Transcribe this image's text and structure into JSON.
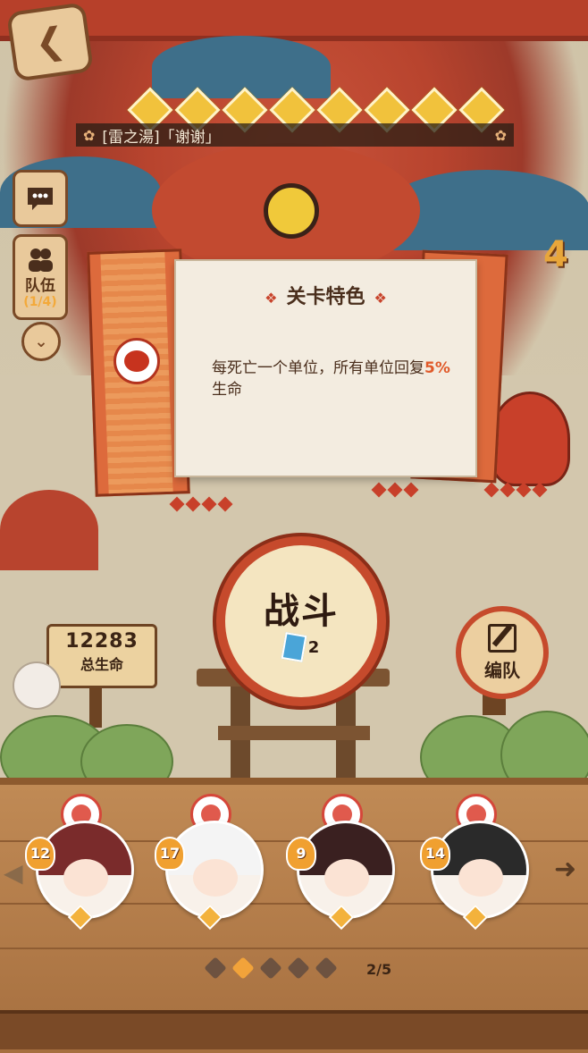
{
  "level": {
    "name": "[雷之湯]「谢谢」",
    "stars": 8
  },
  "sidebar": {
    "team_label": "队伍",
    "team_count": "(1/4)"
  },
  "wave_count": "4",
  "modal": {
    "title": "关卡特色",
    "text_before": "每死亡一个单位，所有单位回复",
    "highlight": "5%",
    "text_after": "生命"
  },
  "fight": {
    "label": "战斗",
    "cost": "2"
  },
  "hp_sign": {
    "value": "12283",
    "label": "总生命"
  },
  "formation": {
    "label": "编队"
  },
  "team": [
    {
      "level": "12",
      "hair": "#7a2b2b"
    },
    {
      "level": "17",
      "hair": "#f4f4f4"
    },
    {
      "level": "9",
      "hair": "#3a2020"
    },
    {
      "level": "14",
      "hair": "#2a2a2a"
    }
  ],
  "pagination": {
    "current": 2,
    "total": 5,
    "label": "2/5"
  },
  "colors": {
    "accent": "#c64a2c",
    "highlight": "#e05a2a",
    "star": "#f1c23c"
  }
}
